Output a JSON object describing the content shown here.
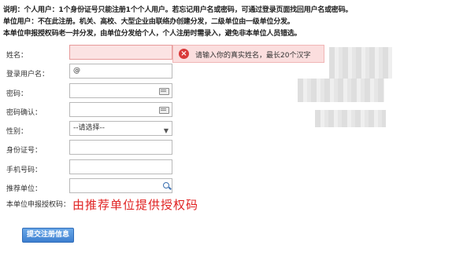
{
  "notes": [
    "说明：个人用户：1个身份证号只能注册1个个人用户。若忘记用户名或密码，可通过登录页面找回用户名或密码。",
    "单位用户：不在此注册。机关、高校、大型企业由联络办创建分发，二级单位由一级单位分发。",
    "本单位申报授权码老一并分发，由单位分发给个人，个人注册时需录入，避免非本单位人员错选。"
  ],
  "form": {
    "name_label": "姓名：",
    "username_label": "登录用户名：",
    "username_value": "@",
    "password_label": "密码：",
    "password_confirm_label": "密码确认：",
    "gender_label": "性别：",
    "gender_selected": "--请选择--",
    "id_label": "身份证号：",
    "phone_label": "手机号码：",
    "recommend_label": "推荐单位：",
    "auth_code_label": "本单位申报授权码：",
    "auth_code_hint": "由推荐单位提供授权码",
    "submit_label": "提交注册信息"
  },
  "error": {
    "message": "请输入你的真实姓名，最长20个汉字",
    "icon": "error-x-icon",
    "color": "#d93a3a"
  }
}
